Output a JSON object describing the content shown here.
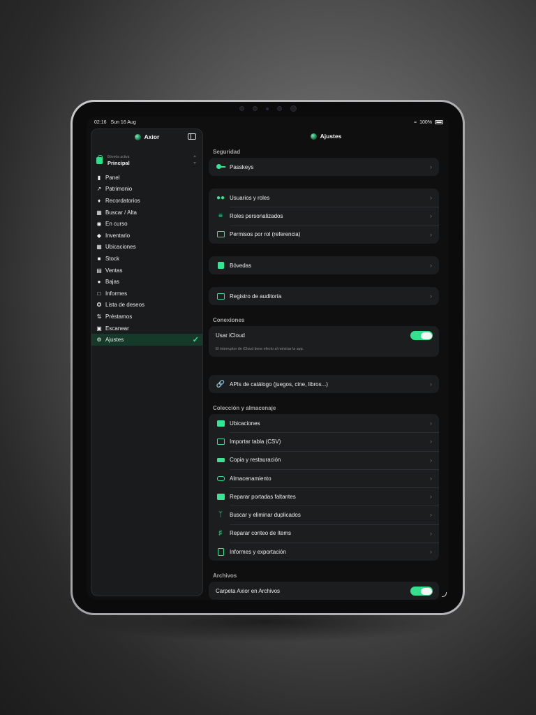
{
  "status": {
    "time": "02:16",
    "date": "Sun 16 Aug",
    "battery": "100%"
  },
  "sidebar": {
    "title": "Axior",
    "vault_caption": "Bóveda activa",
    "vault_name": "Principal",
    "items": [
      {
        "label": "Panel",
        "icon": "chart-bar-icon"
      },
      {
        "label": "Patrimonio",
        "icon": "line-chart-icon"
      },
      {
        "label": "Recordatorios",
        "icon": "bell-icon"
      },
      {
        "label": "Buscar / Alta",
        "icon": "grid-icon"
      },
      {
        "label": "En curso",
        "icon": "play-circle-icon"
      },
      {
        "label": "Inventario",
        "icon": "cube-icon"
      },
      {
        "label": "Ubicaciones",
        "icon": "map-icon"
      },
      {
        "label": "Stock",
        "icon": "archive-icon"
      },
      {
        "label": "Ventas",
        "icon": "barcode-icon"
      },
      {
        "label": "Bajas",
        "icon": "dollar-circle-icon"
      },
      {
        "label": "Informes",
        "icon": "document-icon"
      },
      {
        "label": "Lista de deseos",
        "icon": "star-circle-icon"
      },
      {
        "label": "Préstamos",
        "icon": "arrows-icon"
      },
      {
        "label": "Escanear",
        "icon": "scan-icon"
      },
      {
        "label": "Ajustes",
        "icon": "gear-icon",
        "active": true
      }
    ]
  },
  "main": {
    "title": "Ajustes",
    "sections": {
      "security": "Seguridad",
      "connections": "Conexiones",
      "collection": "Colección y almacenaje",
      "files": "Archivos"
    },
    "rows": {
      "passkeys": "Passkeys",
      "users_roles": "Usuarios y roles",
      "custom_roles": "Roles personalizados",
      "role_perms": "Permisos por rol (referencia)",
      "vaults": "Bóvedas",
      "audit": "Registro de auditoría",
      "icloud": "Usar iCloud",
      "icloud_note": "El interruptor de iCloud tiene efecto al reiniciar la app.",
      "catalog_apis": "APIs de catálogo (juegos, cine, libros...)",
      "locations": "Ubicaciones",
      "import_csv": "Importar tabla (CSV)",
      "backup": "Copia y restauración",
      "storage": "Almacenamiento",
      "fix_covers": "Reparar portadas faltantes",
      "dupes": "Buscar y eliminar duplicados",
      "fix_count": "Reparar conteo de ítems",
      "reports_export": "Informes y exportación",
      "files_folder": "Carpeta Axior en Archivos"
    },
    "toggles": {
      "icloud": true,
      "files_folder": true
    },
    "accent": "#36e593"
  }
}
